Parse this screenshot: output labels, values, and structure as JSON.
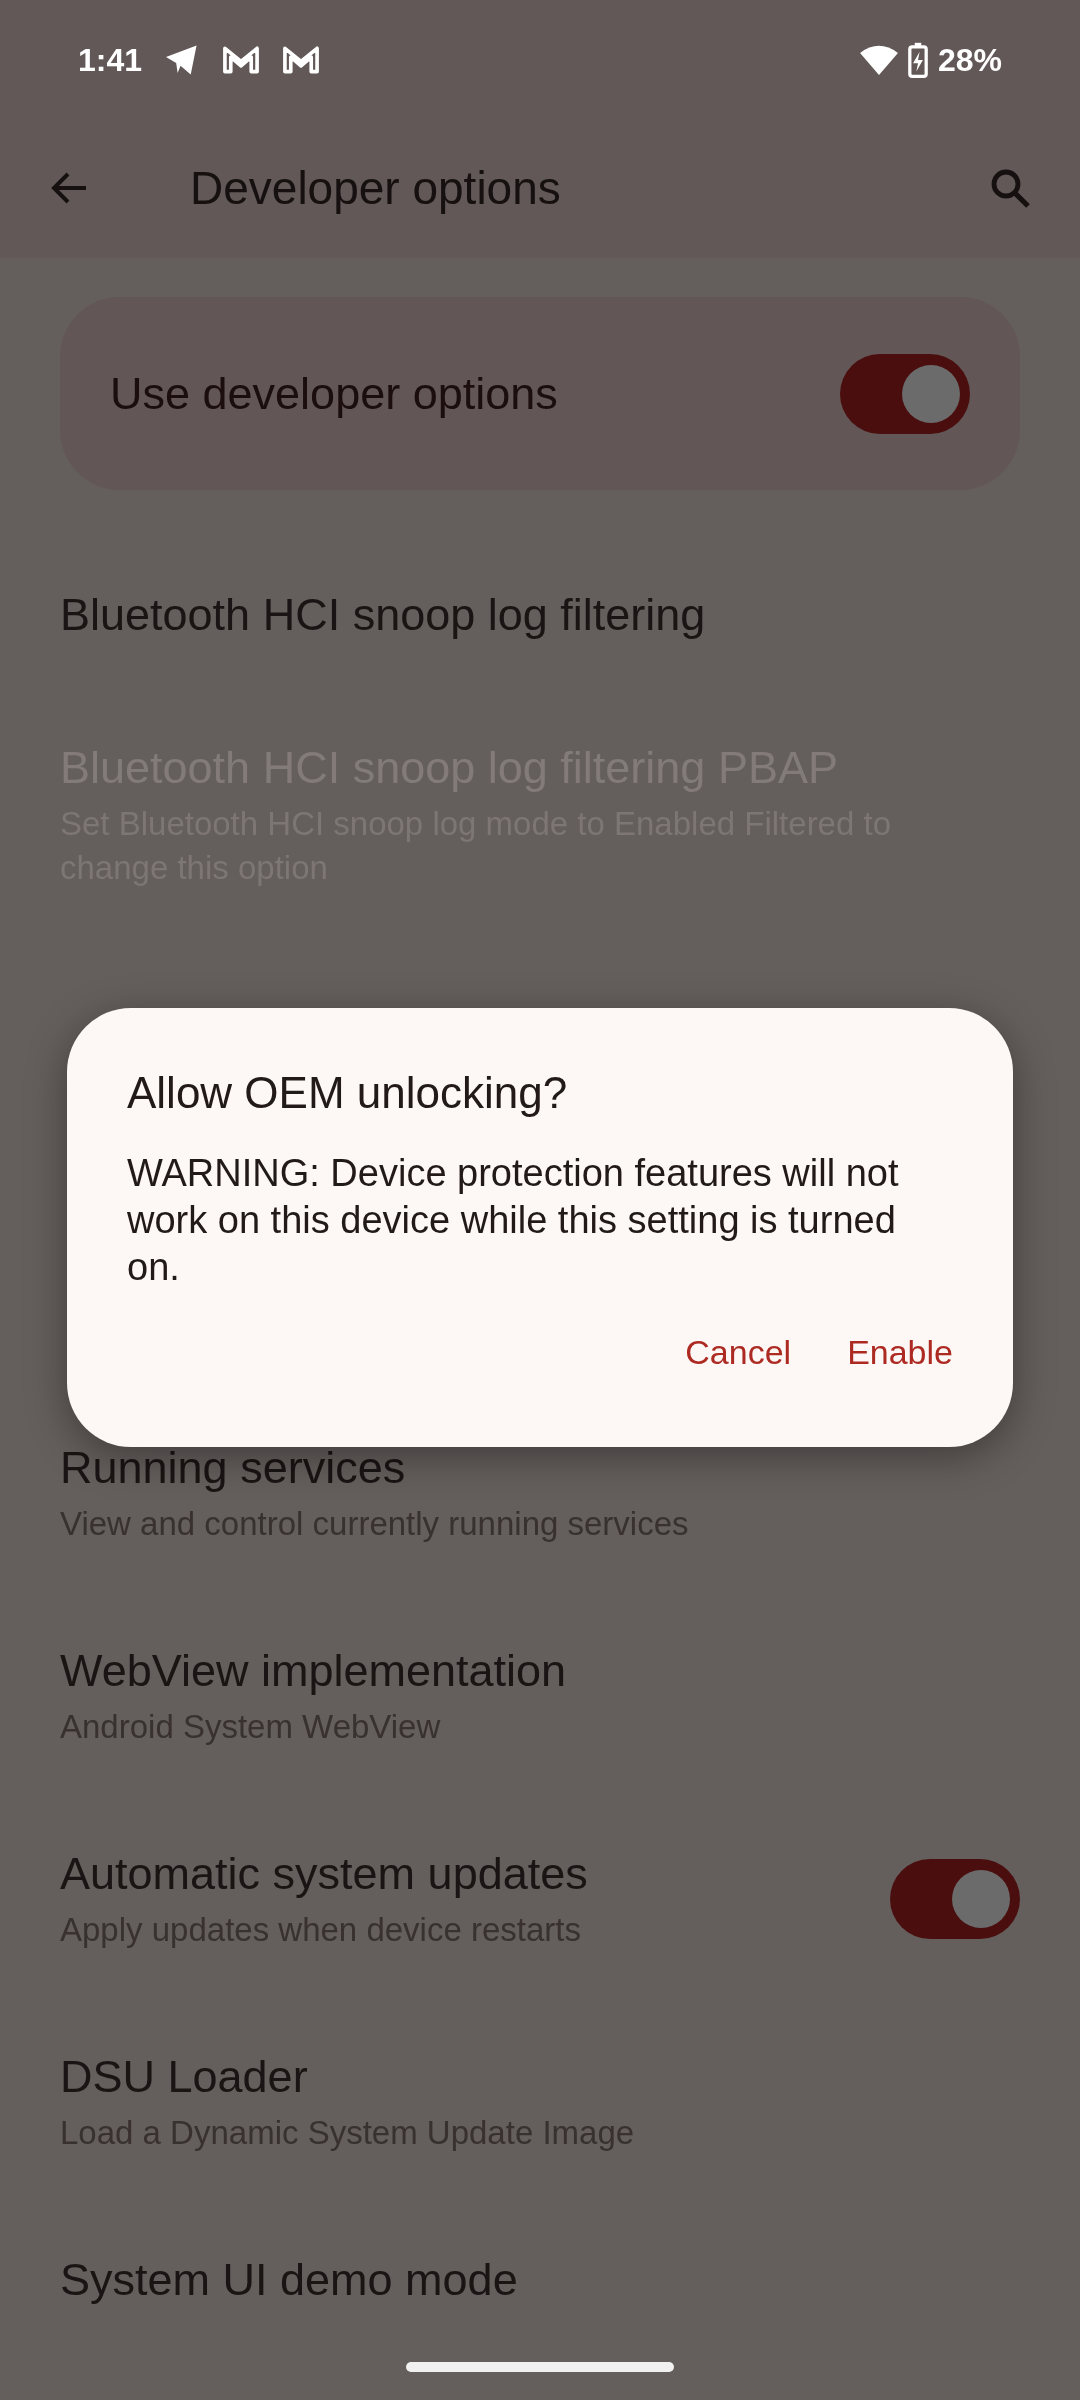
{
  "status_bar": {
    "time": "1:41",
    "battery": "28%"
  },
  "app_bar": {
    "title": "Developer options"
  },
  "main_switch": {
    "label": "Use developer options",
    "on": true
  },
  "items_above": [
    {
      "title": "Bluetooth HCI snoop log filtering",
      "disabled": false
    },
    {
      "title": "Bluetooth HCI snoop log filtering PBAP",
      "subtitle": "Set Bluetooth HCI snoop log mode to Enabled Filtered to change this option",
      "disabled": true
    }
  ],
  "items_below": [
    {
      "title": "Running services",
      "subtitle": "View and control currently running services",
      "disabled": false
    },
    {
      "title": "WebView implementation",
      "subtitle": "Android System WebView",
      "disabled": false
    },
    {
      "title": "Automatic system updates",
      "subtitle": "Apply updates when device restarts",
      "on": true,
      "disabled": false
    },
    {
      "title": "DSU Loader",
      "subtitle": "Load a Dynamic System Update Image",
      "disabled": false
    },
    {
      "title": "System UI demo mode",
      "disabled": false
    }
  ],
  "dialog": {
    "title": "Allow OEM unlocking?",
    "message": "WARNING: Device protection features will not work on this device while this setting is turned on.",
    "buttons": [
      "Cancel",
      "Enable"
    ]
  }
}
